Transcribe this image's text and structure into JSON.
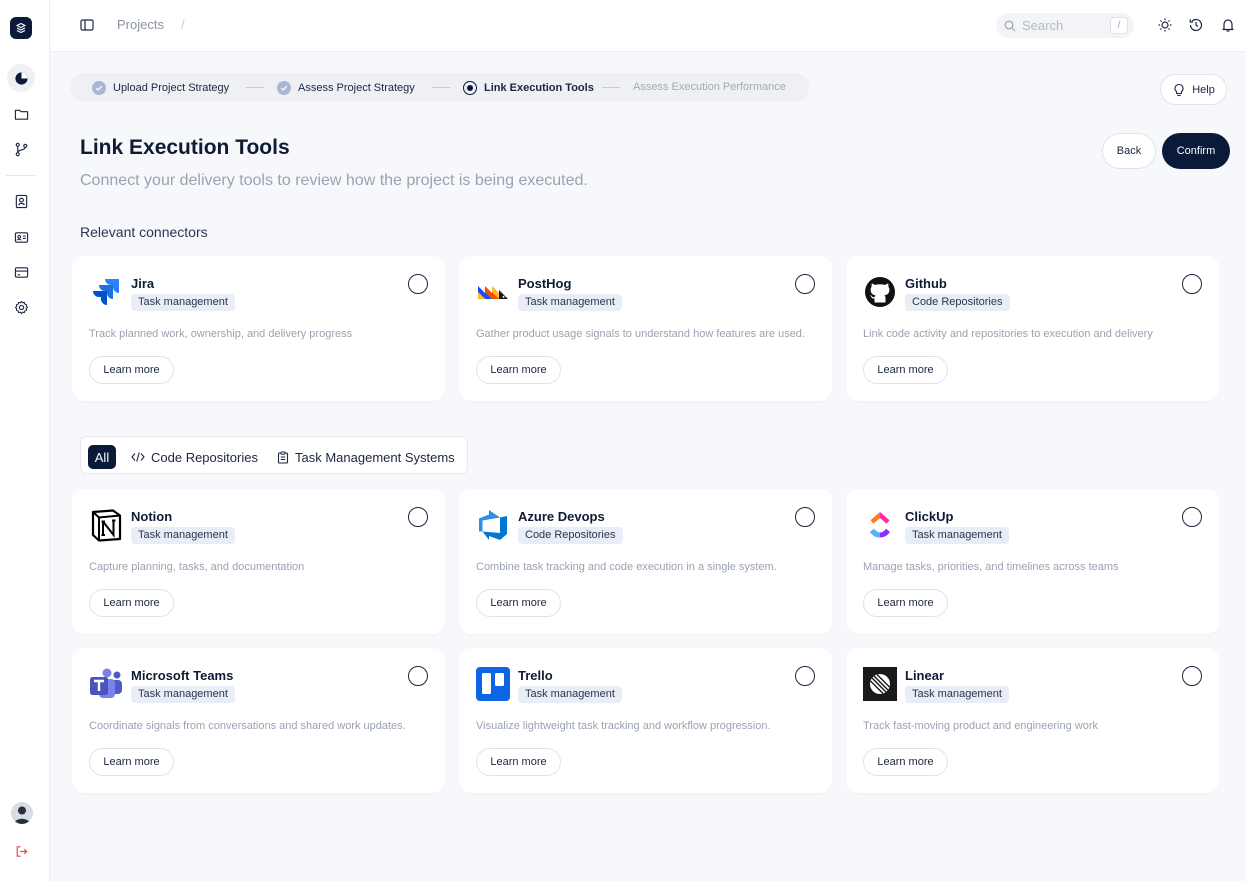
{
  "colors": {
    "brand": "#0b1a38",
    "accent": "#a7b8d2",
    "logout": "#e5484d"
  },
  "topbar": {
    "breadcrumb": "Projects",
    "breadcrumb_sep": "/",
    "search_placeholder": "Search",
    "search_shortcut": "/"
  },
  "stepper": {
    "steps": [
      {
        "label": "Upload Project Strategy",
        "state": "done"
      },
      {
        "label": "Assess Project Strategy",
        "state": "done"
      },
      {
        "label": "Link Execution Tools",
        "state": "current"
      },
      {
        "label": "Assess Execution Performance",
        "state": "upcoming"
      }
    ]
  },
  "help_label": "Help",
  "header": {
    "title": "Link Execution Tools",
    "subtitle": "Connect your delivery tools to review how the project is being executed.",
    "back_label": "Back",
    "confirm_label": "Confirm"
  },
  "relevant": {
    "label": "Relevant connectors",
    "cards": [
      {
        "name": "Jira",
        "tag": "Task management",
        "desc": "Track planned work, ownership, and delivery progress",
        "learn": "Learn more",
        "icon": "jira-icon"
      },
      {
        "name": "PostHog",
        "tag": "Task management",
        "desc": "Gather product usage signals to understand how features are used.",
        "learn": "Learn more",
        "icon": "posthog-icon"
      },
      {
        "name": "Github",
        "tag": "Code Repositories",
        "desc": "Link code activity and repositories to execution and delivery",
        "learn": "Learn more",
        "icon": "github-icon"
      }
    ]
  },
  "filters": {
    "all": "All",
    "code": "Code Repositories",
    "task": "Task Management Systems"
  },
  "catalog": {
    "cards": [
      {
        "name": "Notion",
        "tag": "Task management",
        "desc": "Capture planning, tasks, and documentation",
        "learn": "Learn more",
        "icon": "notion-icon"
      },
      {
        "name": "Azure Devops",
        "tag": "Code Repositories",
        "desc": "Combine task tracking and code execution in a single system.",
        "learn": "Learn more",
        "icon": "azure-devops-icon"
      },
      {
        "name": "ClickUp",
        "tag": "Task management",
        "desc": "Manage tasks, priorities, and timelines across teams",
        "learn": "Learn more",
        "icon": "clickup-icon"
      },
      {
        "name": "Microsoft Teams",
        "tag": "Task management",
        "desc": "Coordinate signals from conversations and shared work updates.",
        "learn": "Learn more",
        "icon": "microsoft-teams-icon"
      },
      {
        "name": "Trello",
        "tag": "Task management",
        "desc": "Visualize lightweight task tracking and workflow progression.",
        "learn": "Learn more",
        "icon": "trello-icon"
      },
      {
        "name": "Linear",
        "tag": "Task management",
        "desc": "Track fast-moving product and engineering work",
        "learn": "Learn more",
        "icon": "linear-icon"
      }
    ]
  }
}
